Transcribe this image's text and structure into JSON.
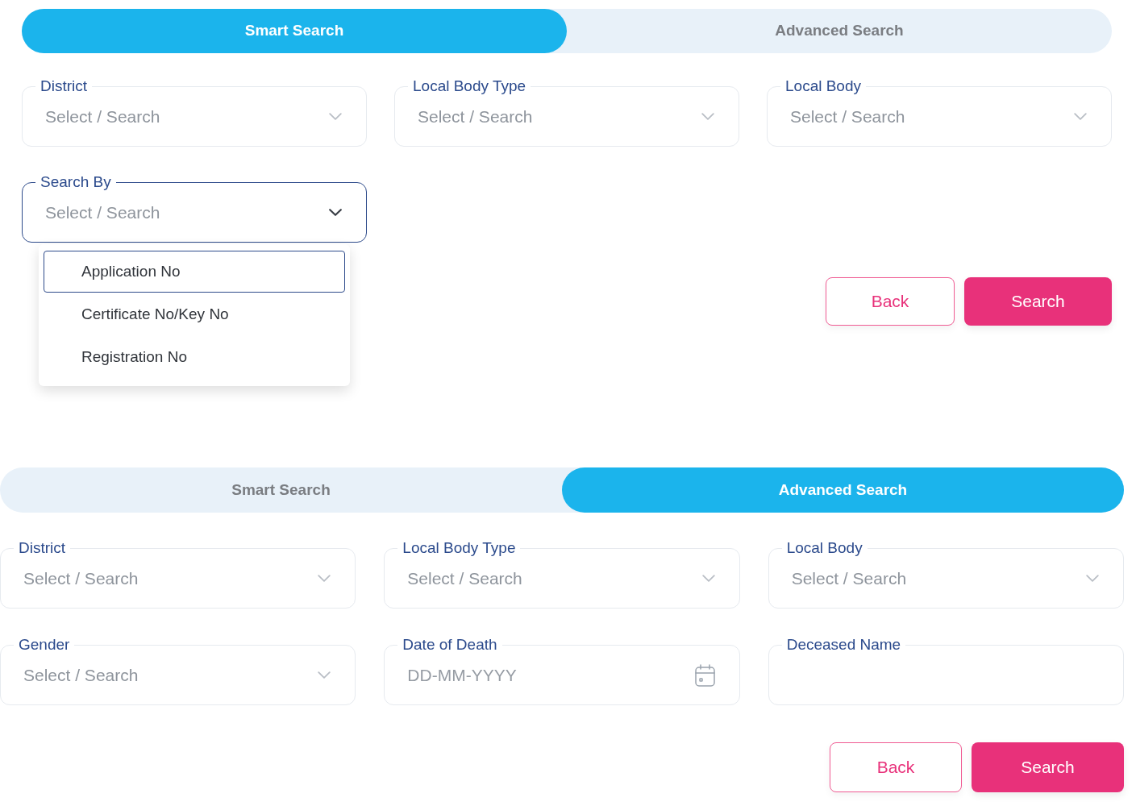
{
  "panels": [
    {
      "tabs": [
        {
          "label": "Smart Search",
          "selected": true
        },
        {
          "label": "Advanced Search",
          "selected": false
        }
      ],
      "fields": [
        {
          "kind": "select",
          "label": "District",
          "placeholder": "Select / Search",
          "expanded": false
        },
        {
          "kind": "select",
          "label": "Local Body Type",
          "placeholder": "Select / Search",
          "expanded": false
        },
        {
          "kind": "select",
          "label": "Local Body",
          "placeholder": "Select / Search",
          "expanded": false
        },
        {
          "kind": "select",
          "label": "Search By",
          "placeholder": "Select / Search",
          "expanded": true,
          "options": [
            {
              "label": "Application No",
              "selected": true
            },
            {
              "label": "Certificate No/Key No",
              "selected": false
            },
            {
              "label": "Registration No",
              "selected": false
            }
          ]
        }
      ],
      "buttons": [
        {
          "kind": "secondary",
          "label": "Back"
        },
        {
          "kind": "primary",
          "label": "Search"
        }
      ]
    },
    {
      "tabs": [
        {
          "label": "Smart Search",
          "selected": false
        },
        {
          "label": "Advanced Search",
          "selected": true
        }
      ],
      "fields": [
        {
          "kind": "select",
          "label": "District",
          "placeholder": "Select / Search",
          "expanded": false
        },
        {
          "kind": "select",
          "label": "Local Body Type",
          "placeholder": "Select / Search",
          "expanded": false
        },
        {
          "kind": "select",
          "label": "Local Body",
          "placeholder": "Select / Search",
          "expanded": false
        },
        {
          "kind": "select",
          "label": "Gender",
          "placeholder": "Select / Search",
          "expanded": false
        },
        {
          "kind": "date",
          "label": "Date of Death",
          "placeholder": "DD-MM-YYYY"
        },
        {
          "kind": "text",
          "label": "Deceased Name"
        }
      ],
      "buttons": [
        {
          "kind": "secondary",
          "label": "Back"
        },
        {
          "kind": "primary",
          "label": "Search"
        }
      ]
    }
  ]
}
